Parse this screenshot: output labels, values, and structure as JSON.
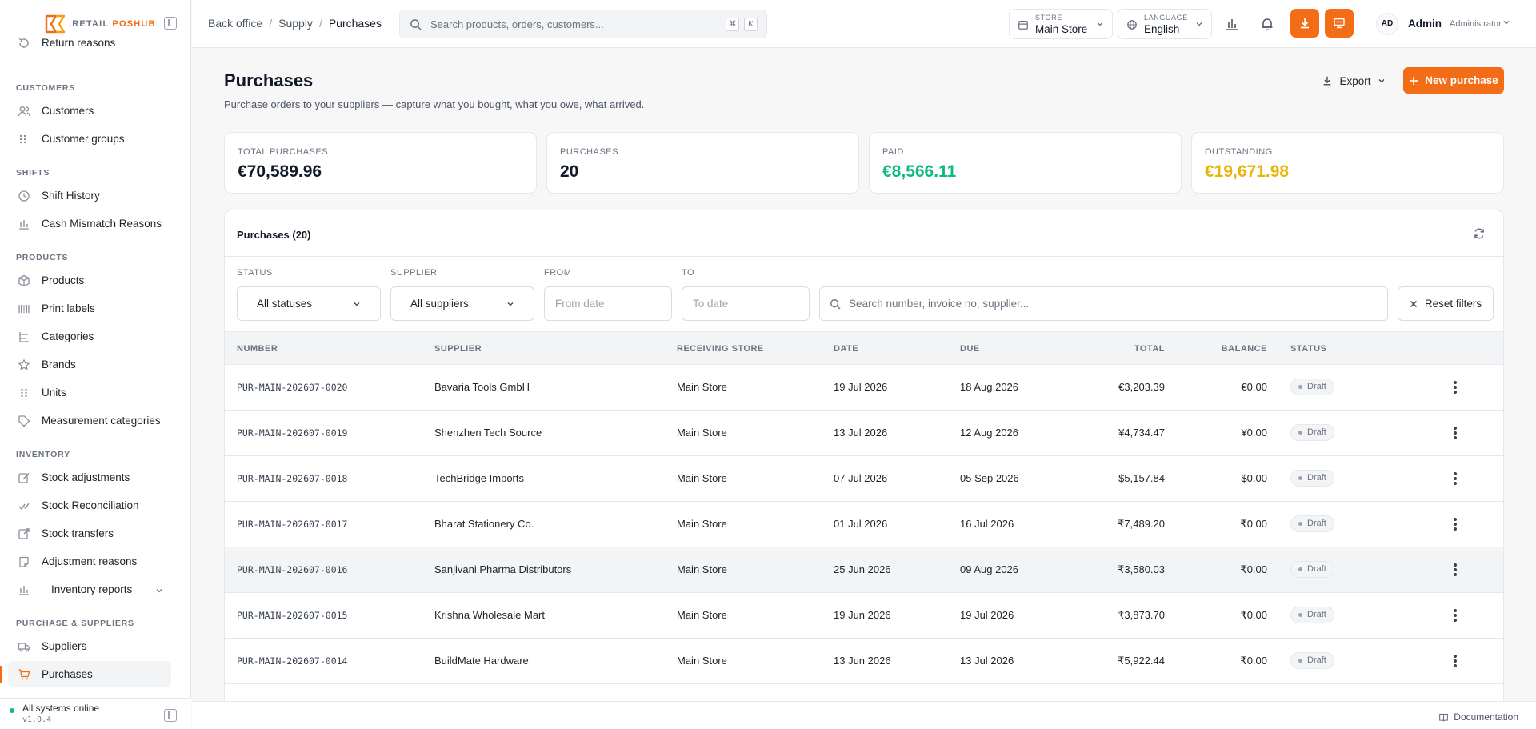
{
  "brand": {
    "prefix": ".RETAIL ",
    "suffix": "POSHUB"
  },
  "sidebar": {
    "top_item": "Return reasons",
    "sections": [
      {
        "title": "CUSTOMERS",
        "items": [
          "Customers",
          "Customer groups"
        ]
      },
      {
        "title": "SHIFTS",
        "items": [
          "Shift History",
          "Cash Mismatch Reasons"
        ]
      },
      {
        "title": "PRODUCTS",
        "items": [
          "Products",
          "Print labels",
          "Categories",
          "Brands",
          "Units",
          "Measurement categories"
        ]
      },
      {
        "title": "INVENTORY",
        "items": [
          "Stock adjustments",
          "Stock Reconciliation",
          "Stock transfers",
          "Adjustment reasons",
          "Inventory reports"
        ]
      },
      {
        "title": "PURCHASE & SUPPLIERS",
        "items": [
          "Suppliers",
          "Purchases"
        ]
      }
    ],
    "status": "All systems online",
    "version": "v1.0.4"
  },
  "topbar": {
    "breadcrumb": [
      "Back office",
      "Supply",
      "Purchases"
    ],
    "search_placeholder": "Search products, orders, customers...",
    "kbd": [
      "⌘",
      "K"
    ],
    "store_label": "STORE",
    "store_value": "Main Store",
    "language_label": "LANGUAGE",
    "language_value": "English",
    "avatar": "AD",
    "user_name": "Admin",
    "user_role": "Administrator"
  },
  "page": {
    "title": "Purchases",
    "subtitle": "Purchase orders to your suppliers — capture what you bought, what you owe, what arrived.",
    "export": "Export",
    "new_purchase": "New purchase"
  },
  "stats": [
    {
      "label": "TOTAL PURCHASES",
      "value": "€70,589.96",
      "color": "#111827"
    },
    {
      "label": "PURCHASES",
      "value": "20",
      "color": "#111827"
    },
    {
      "label": "PAID",
      "value": "€8,566.11",
      "color": "#10b981"
    },
    {
      "label": "OUTSTANDING",
      "value": "€19,671.98",
      "color": "#eab308"
    }
  ],
  "table_card": {
    "title": "Purchases (20)",
    "filters": {
      "status_label": "STATUS",
      "status_value": "All statuses",
      "supplier_label": "SUPPLIER",
      "supplier_value": "All suppliers",
      "from_label": "FROM",
      "from_placeholder": "From date",
      "to_label": "TO",
      "to_placeholder": "To date",
      "search_placeholder": "Search number, invoice no, supplier...",
      "reset": "Reset filters"
    },
    "columns": [
      "NUMBER",
      "SUPPLIER",
      "RECEIVING STORE",
      "DATE",
      "DUE",
      "TOTAL",
      "BALANCE",
      "STATUS"
    ],
    "rows": [
      {
        "number": "PUR-MAIN-202607-0020",
        "supplier": "Bavaria Tools GmbH",
        "store": "Main Store",
        "date": "19 Jul 2026",
        "due": "18 Aug 2026",
        "total": "€3,203.39",
        "balance": "€0.00",
        "status": "Draft"
      },
      {
        "number": "PUR-MAIN-202607-0019",
        "supplier": "Shenzhen Tech Source",
        "store": "Main Store",
        "date": "13 Jul 2026",
        "due": "12 Aug 2026",
        "total": "¥4,734.47",
        "balance": "¥0.00",
        "status": "Draft"
      },
      {
        "number": "PUR-MAIN-202607-0018",
        "supplier": "TechBridge Imports",
        "store": "Main Store",
        "date": "07 Jul 2026",
        "due": "05 Sep 2026",
        "total": "$5,157.84",
        "balance": "$0.00",
        "status": "Draft"
      },
      {
        "number": "PUR-MAIN-202607-0017",
        "supplier": "Bharat Stationery Co.",
        "store": "Main Store",
        "date": "01 Jul 2026",
        "due": "16 Jul 2026",
        "total": "₹7,489.20",
        "balance": "₹0.00",
        "status": "Draft"
      },
      {
        "number": "PUR-MAIN-202607-0016",
        "supplier": "Sanjivani Pharma Distributors",
        "store": "Main Store",
        "date": "25 Jun 2026",
        "due": "09 Aug 2026",
        "total": "₹3,580.03",
        "balance": "₹0.00",
        "status": "Draft"
      },
      {
        "number": "PUR-MAIN-202607-0015",
        "supplier": "Krishna Wholesale Mart",
        "store": "Main Store",
        "date": "19 Jun 2026",
        "due": "19 Jul 2026",
        "total": "₹3,873.70",
        "balance": "₹0.00",
        "status": "Draft"
      },
      {
        "number": "PUR-MAIN-202607-0014",
        "supplier": "BuildMate Hardware",
        "store": "Main Store",
        "date": "13 Jun 2026",
        "due": "13 Jul 2026",
        "total": "₹5,922.44",
        "balance": "₹0.00",
        "status": "Draft"
      }
    ]
  },
  "footer": {
    "documentation": "Documentation"
  },
  "colors": {
    "accent": "#f36c16"
  }
}
